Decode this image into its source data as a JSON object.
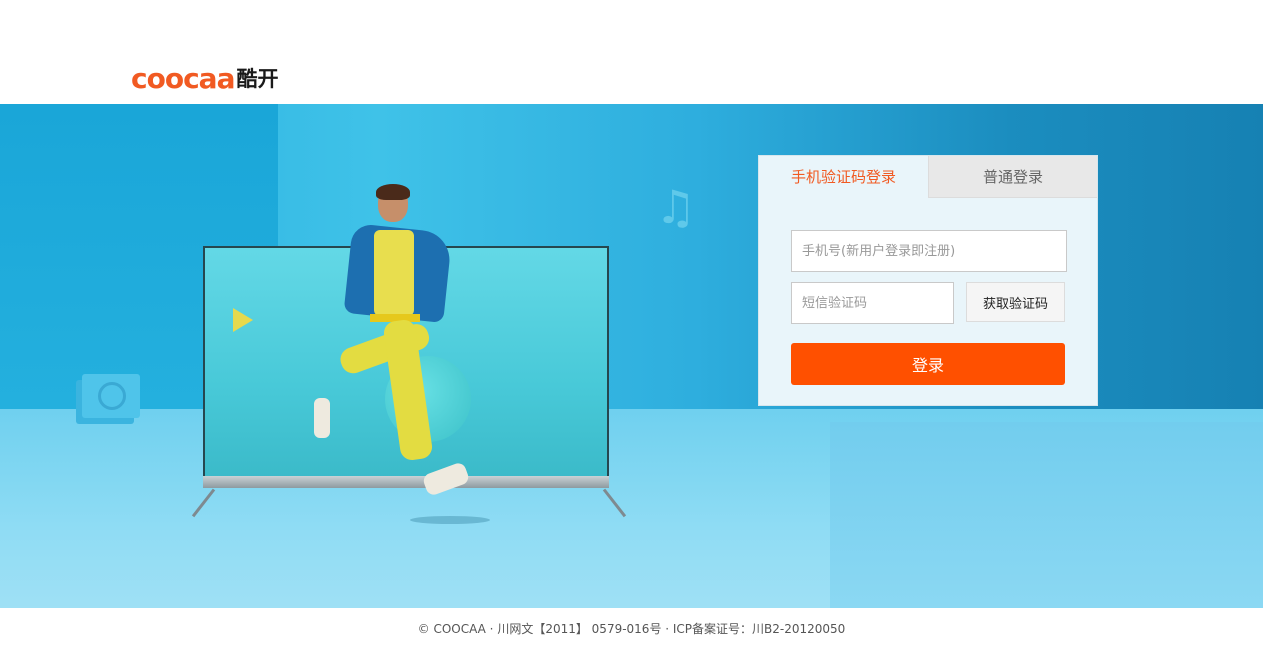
{
  "header": {
    "logo_latin": "coocaa",
    "logo_cn": "酷开"
  },
  "login": {
    "tabs": [
      {
        "label": "手机验证码登录",
        "active": true
      },
      {
        "label": "普通登录",
        "active": false
      }
    ],
    "phone_placeholder": "手机号(新用户登录即注册)",
    "phone_value": "",
    "code_placeholder": "短信验证码",
    "code_value": "",
    "get_code_label": "获取验证码",
    "submit_label": "登录"
  },
  "footer": {
    "text": "© COOCAA · 川网文【2011】 0579-016号 · ICP备案证号：川B2-20120050"
  },
  "colors": {
    "accent": "#f15a22",
    "button": "#ff5000",
    "banner": "#2eaede"
  }
}
